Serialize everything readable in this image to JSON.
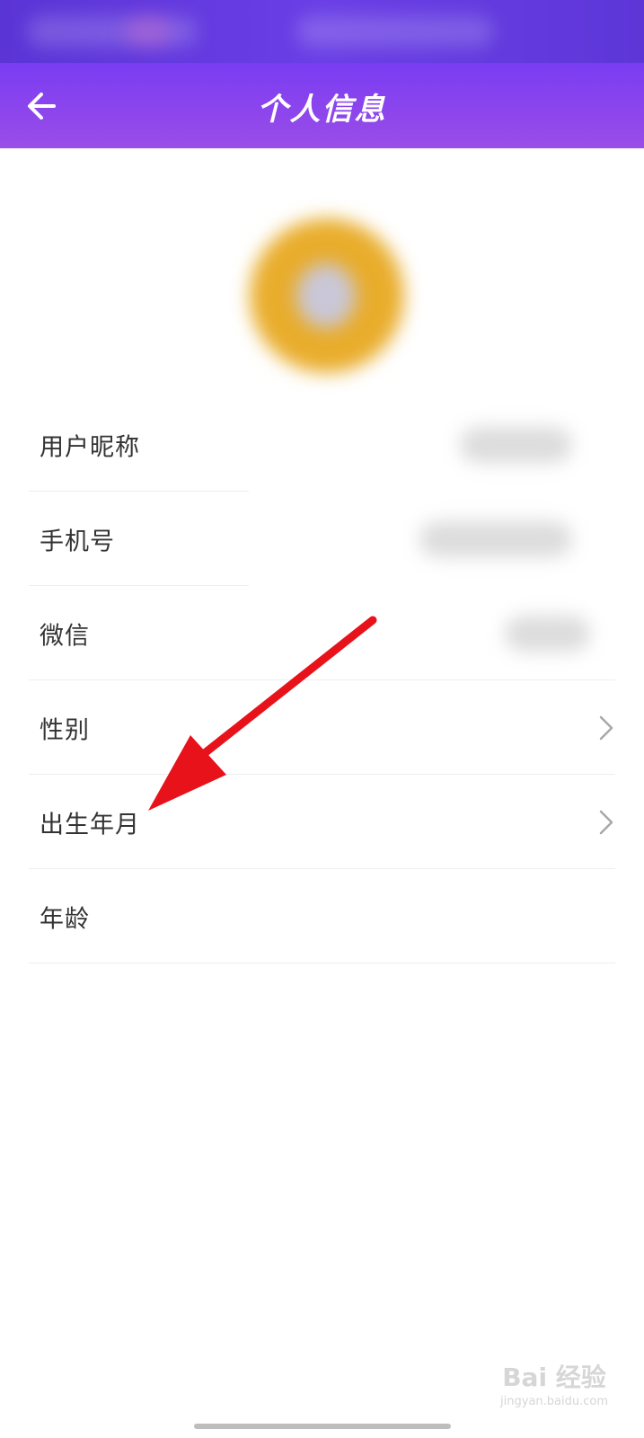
{
  "header": {
    "title": "个人信息",
    "back_icon": "arrow-left-icon"
  },
  "avatar": {
    "description": ""
  },
  "info_rows": [
    {
      "label": "用户昵称",
      "has_chevron": false
    },
    {
      "label": "手机号",
      "has_chevron": false
    },
    {
      "label": "微信",
      "has_chevron": false
    },
    {
      "label": "性别",
      "has_chevron": true
    },
    {
      "label": "出生年月",
      "has_chevron": true
    },
    {
      "label": "年龄",
      "has_chevron": false
    }
  ],
  "watermark": {
    "text": "Bai 经验",
    "sub": "jingyan.baidu.com"
  },
  "colors": {
    "header_start": "#7a3cf2",
    "header_end": "#9a4de8",
    "annotation": "#e8121b",
    "label_text": "#333333",
    "divider": "#eeeeee"
  }
}
